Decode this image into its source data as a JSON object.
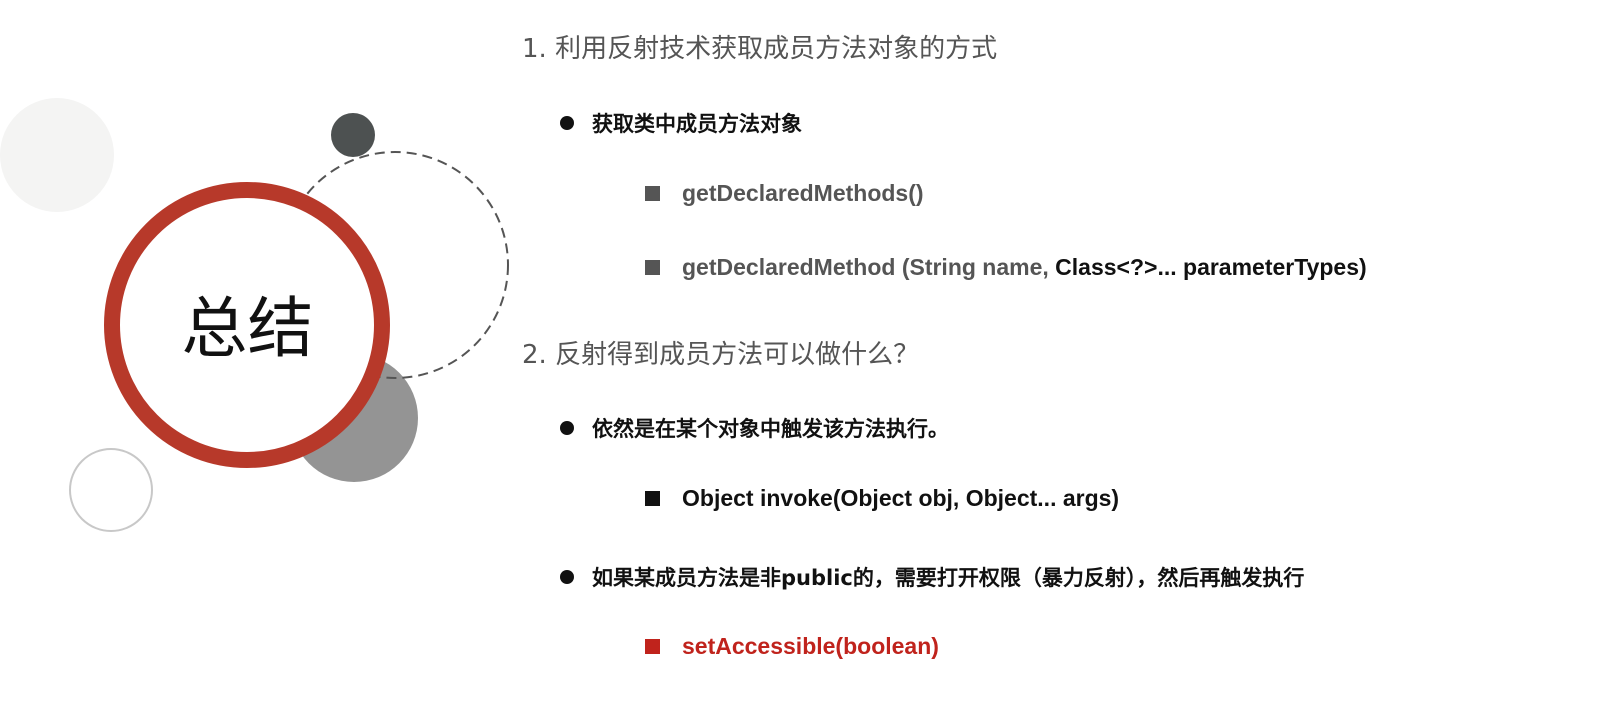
{
  "title": "总结",
  "colors": {
    "accent": "#b7392a",
    "dark_circle": "#4d5151",
    "mid_circle": "#949494",
    "highlight_text": "#c0231c"
  },
  "sections": [
    {
      "heading": "1. 利用反射技术获取成员方法对象的方式",
      "bullet": "获取类中成员方法对象",
      "items": [
        {
          "text": "getDeclaredMethods()"
        },
        {
          "text": "getDeclaredMethod (String name, ",
          "text2": "Class<?>... parameterTypes)"
        }
      ]
    },
    {
      "heading": "2. 反射得到成员方法可以做什么？",
      "bullet": "依然是在某个对象中触发该方法执行。",
      "item": "Object invoke(Object obj, Object... args)",
      "bullet2": "如果某成员方法是非public的，需要打开权限（暴力反射），然后再触发执行",
      "item2": "setAccessible(boolean)"
    }
  ]
}
